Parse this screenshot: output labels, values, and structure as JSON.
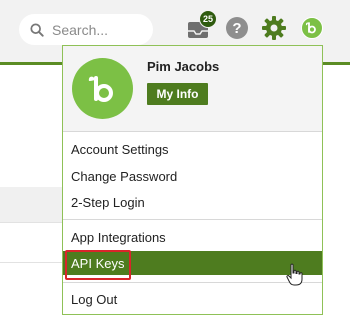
{
  "header": {
    "search": {
      "placeholder": "Search..."
    },
    "inbox_badge": "25",
    "help_label": "?"
  },
  "profile": {
    "name": "Pim Jacobs",
    "my_info_label": "My Info"
  },
  "menu": {
    "items": [
      {
        "label": "Account Settings"
      },
      {
        "label": "Change Password"
      },
      {
        "label": "2-Step Login"
      },
      {
        "label": "App Integrations"
      },
      {
        "label": "API Keys"
      },
      {
        "label": "Log Out"
      }
    ]
  },
  "colors": {
    "brand_green": "#7cc045",
    "dark_green": "#4e7c1f",
    "highlight_red": "#d9252a"
  },
  "icons": [
    "search-icon",
    "inbox-icon",
    "help-icon",
    "gear-icon",
    "bamboo-logo-icon",
    "hand-cursor-icon"
  ]
}
